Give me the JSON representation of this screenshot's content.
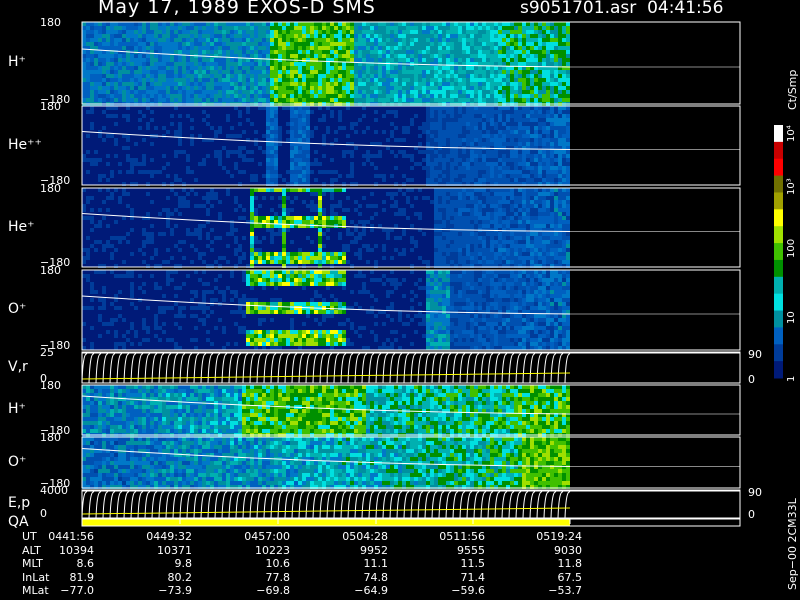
{
  "header": {
    "title": "May 17, 1989   EXOS-D SMS",
    "file": "s9051701.asr",
    "time": "04:41:56"
  },
  "colorbar": {
    "title": "Ct/Smp",
    "labels": [
      "10⁴",
      "10³",
      "100",
      "10",
      "1"
    ],
    "colors": [
      "#ffffff",
      "#c80000",
      "#ff0000",
      "#707000",
      "#a0a000",
      "#ffff00",
      "#a0e000",
      "#40c000",
      "#009000",
      "#00b0b0",
      "#00e0e0",
      "#0090a0",
      "#0060c0",
      "#003c9a",
      "#001a78"
    ]
  },
  "panels": [
    {
      "id": "h-plus",
      "label": "H⁺",
      "ymax": "180",
      "ymin": "−180"
    },
    {
      "id": "he-pp",
      "label": "He⁺⁺",
      "ymax": "180",
      "ymin": "−180"
    },
    {
      "id": "he-plus",
      "label": "He⁺",
      "ymax": "180",
      "ymin": "−180"
    },
    {
      "id": "o-plus",
      "label": "O⁺",
      "ymax": "180",
      "ymin": "−180"
    },
    {
      "id": "vr",
      "label": "V,r",
      "ymax": "25",
      "ymin": "0",
      "rmax": "90",
      "rmin": "0"
    },
    {
      "id": "h-plus-2",
      "label": "H⁺",
      "ymax": "180",
      "ymin": "−180"
    },
    {
      "id": "o-plus-2",
      "label": "O⁺",
      "ymax": "180",
      "ymin": "−180"
    },
    {
      "id": "ep",
      "label": "E,p",
      "ymax": "4000",
      "ymin": "0",
      "rmax": "90",
      "rmin": "0"
    },
    {
      "id": "qa",
      "label": "QA"
    }
  ],
  "ephemeris": {
    "rows": [
      {
        "label": "UT",
        "values": [
          "0441:56",
          "0449:32",
          "0457:00",
          "0504:28",
          "0511:56",
          "0519:24"
        ]
      },
      {
        "label": "ALT",
        "values": [
          "10394",
          "10371",
          "10223",
          "9952",
          "9555",
          "9030"
        ]
      },
      {
        "label": "MLT",
        "values": [
          "8.6",
          "9.8",
          "10.6",
          "11.1",
          "11.5",
          "11.8"
        ]
      },
      {
        "label": "InLat",
        "values": [
          "81.9",
          "80.2",
          "77.8",
          "74.8",
          "71.4",
          "67.5"
        ]
      },
      {
        "label": "MLat",
        "values": [
          "−77.0",
          "−73.9",
          "−69.8",
          "−64.9",
          "−59.6",
          "−53.7"
        ]
      }
    ]
  },
  "side_note": "Sep−00  2CM33L",
  "chart_data": {
    "type": "heatmap",
    "title": "May 17, 1989   EXOS-D SMS",
    "x_ticks": [
      "0441:56",
      "0449:32",
      "0457:00",
      "0504:28",
      "0511:56",
      "0519:24"
    ],
    "z_label": "Ct/Smp",
    "z_scale": "log",
    "z_range": [
      1,
      10000
    ],
    "series": [
      {
        "name": "H⁺",
        "ylim": [
          -180,
          180
        ]
      },
      {
        "name": "He⁺⁺",
        "ylim": [
          -180,
          180
        ]
      },
      {
        "name": "He⁺",
        "ylim": [
          -180,
          180
        ]
      },
      {
        "name": "O⁺",
        "ylim": [
          -180,
          180
        ]
      },
      {
        "name": "V,r",
        "ylim": [
          0,
          25
        ],
        "y2lim": [
          0,
          90
        ]
      },
      {
        "name": "H⁺",
        "ylim": [
          -180,
          180
        ]
      },
      {
        "name": "O⁺",
        "ylim": [
          -180,
          180
        ]
      },
      {
        "name": "E,p",
        "ylim": [
          0,
          4000
        ],
        "y2lim": [
          0,
          90
        ]
      },
      {
        "name": "QA"
      }
    ]
  }
}
